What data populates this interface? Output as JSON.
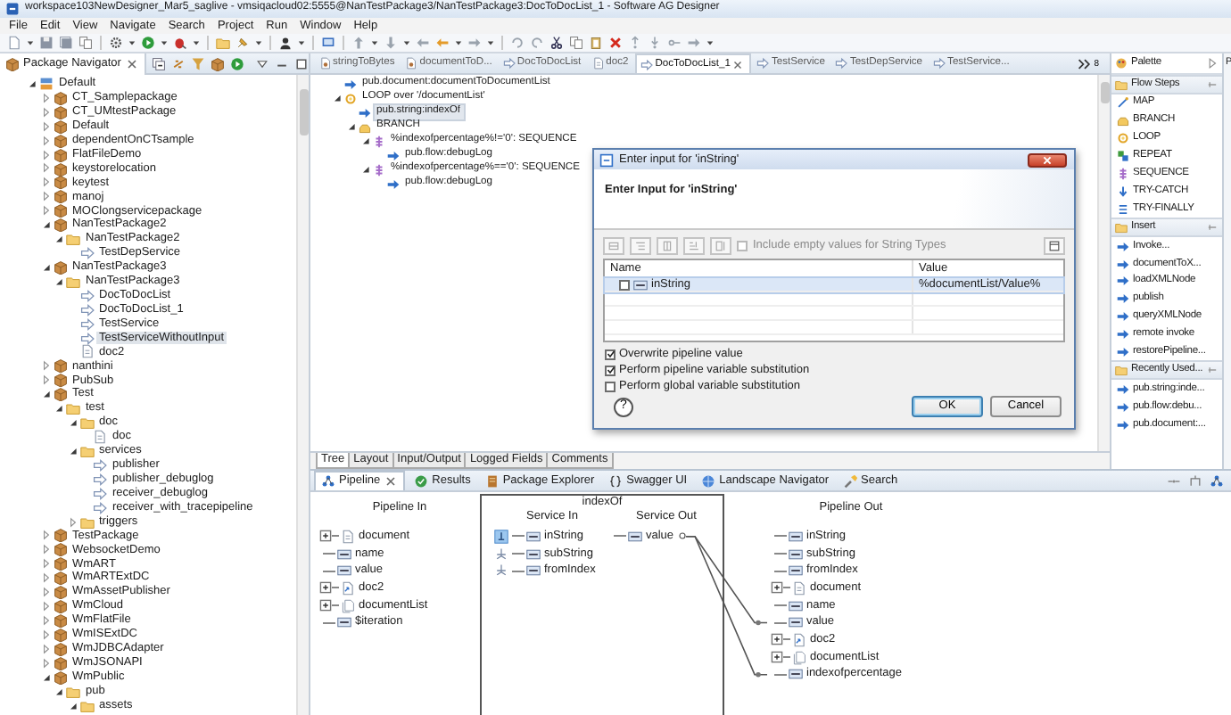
{
  "window": {
    "title": "workspace103NewDesigner_Mar5_saglive - vmsiqacloud02:5555@NanTestPackage3/NanTestPackage3:DocToDocList_1 - Software AG Designer"
  },
  "menu": [
    "File",
    "Edit",
    "View",
    "Navigate",
    "Search",
    "Project",
    "Run",
    "Window",
    "Help"
  ],
  "navigator": {
    "tab": {
      "label": "Package Navigator",
      "selected": true
    },
    "tree": [
      {
        "label": "Default",
        "kind": "server",
        "expanded": true,
        "selected": false,
        "children": [
          {
            "label": "CT_Samplepackage",
            "kind": "package",
            "expanded": false,
            "selected": false
          },
          {
            "label": "CT_UMtestPackage",
            "kind": "package",
            "expanded": false,
            "selected": false
          },
          {
            "label": "Default",
            "kind": "package",
            "expanded": false,
            "selected": false
          },
          {
            "label": "dependentOnCTsample",
            "kind": "package",
            "expanded": false,
            "selected": false
          },
          {
            "label": "FlatFileDemo",
            "kind": "package",
            "expanded": false,
            "selected": false
          },
          {
            "label": "keystorelocation",
            "kind": "package",
            "expanded": false,
            "selected": false
          },
          {
            "label": "keytest",
            "kind": "package",
            "expanded": false,
            "selected": false
          },
          {
            "label": "manoj",
            "kind": "package",
            "expanded": false,
            "selected": false
          },
          {
            "label": "MOClongservicepackage",
            "kind": "package",
            "expanded": false,
            "selected": false
          },
          {
            "label": "NanTestPackage2",
            "kind": "package",
            "expanded": true,
            "selected": false,
            "children": [
              {
                "label": "NanTestPackage2",
                "kind": "folder",
                "expanded": true,
                "selected": false,
                "children": [
                  {
                    "label": "TestDepService",
                    "kind": "service",
                    "selected": false
                  }
                ]
              }
            ]
          },
          {
            "label": "NanTestPackage3",
            "kind": "package",
            "expanded": true,
            "selected": false,
            "children": [
              {
                "label": "NanTestPackage3",
                "kind": "folder",
                "expanded": true,
                "selected": false,
                "children": [
                  {
                    "label": "DocToDocList",
                    "kind": "service",
                    "selected": false
                  },
                  {
                    "label": "DocToDocList_1",
                    "kind": "service",
                    "selected": false
                  },
                  {
                    "label": "TestService",
                    "kind": "service",
                    "selected": false
                  },
                  {
                    "label": "TestServiceWithoutInput",
                    "kind": "service",
                    "selected": true
                  },
                  {
                    "label": "doc2",
                    "kind": "document",
                    "selected": false
                  }
                ]
              }
            ]
          },
          {
            "label": "nanthini",
            "kind": "package",
            "expanded": false,
            "selected": false
          },
          {
            "label": "PubSub",
            "kind": "package",
            "expanded": false,
            "selected": false
          },
          {
            "label": "Test",
            "kind": "package",
            "expanded": true,
            "selected": false,
            "children": [
              {
                "label": "test",
                "kind": "folder",
                "expanded": true,
                "selected": false,
                "children": [
                  {
                    "label": "doc",
                    "kind": "folder",
                    "expanded": true,
                    "selected": false,
                    "children": [
                      {
                        "label": "doc",
                        "kind": "document",
                        "selected": false
                      }
                    ]
                  },
                  {
                    "label": "services",
                    "kind": "folder",
                    "expanded": true,
                    "selected": false,
                    "children": [
                      {
                        "label": "publisher",
                        "kind": "service",
                        "selected": false
                      },
                      {
                        "label": "publisher_debuglog",
                        "kind": "service",
                        "selected": false
                      },
                      {
                        "label": "receiver_debuglog",
                        "kind": "service",
                        "selected": false
                      },
                      {
                        "label": "receiver_with_tracepipeline",
                        "kind": "service",
                        "selected": false
                      }
                    ]
                  },
                  {
                    "label": "triggers",
                    "kind": "folder",
                    "expanded": false,
                    "selected": false
                  }
                ]
              }
            ]
          },
          {
            "label": "TestPackage",
            "kind": "package",
            "expanded": false,
            "selected": false
          },
          {
            "label": "WebsocketDemo",
            "kind": "package",
            "expanded": false,
            "selected": false
          },
          {
            "label": "WmART",
            "kind": "package",
            "expanded": false,
            "selected": false
          },
          {
            "label": "WmARTExtDC",
            "kind": "package",
            "expanded": false,
            "selected": false
          },
          {
            "label": "WmAssetPublisher",
            "kind": "package",
            "expanded": false,
            "selected": false
          },
          {
            "label": "WmCloud",
            "kind": "package",
            "expanded": false,
            "selected": false
          },
          {
            "label": "WmFlatFile",
            "kind": "package",
            "expanded": false,
            "selected": false
          },
          {
            "label": "WmISExtDC",
            "kind": "package",
            "expanded": false,
            "selected": false
          },
          {
            "label": "WmJDBCAdapter",
            "kind": "package",
            "expanded": false,
            "selected": false
          },
          {
            "label": "WmJSONAPI",
            "kind": "package",
            "expanded": false,
            "selected": false
          },
          {
            "label": "WmPublic",
            "kind": "package",
            "expanded": true,
            "selected": false,
            "children": [
              {
                "label": "pub",
                "kind": "folder",
                "expanded": true,
                "selected": false,
                "children": [
                  {
                    "label": "assets",
                    "kind": "folder",
                    "expanded": true,
                    "selected": false
                  }
                ]
              }
            ]
          }
        ]
      }
    ]
  },
  "editor": {
    "tabs": [
      {
        "label": "stringToBytes",
        "kind": "java",
        "selected": false
      },
      {
        "label": "documentToD...",
        "kind": "java",
        "selected": false
      },
      {
        "label": "DocToDocList",
        "kind": "service",
        "selected": false
      },
      {
        "label": "doc2",
        "kind": "document",
        "selected": false
      },
      {
        "label": "DocToDocList_1",
        "kind": "service",
        "selected": true
      },
      {
        "label": "TestService",
        "kind": "service",
        "selected": false
      },
      {
        "label": "TestDepService",
        "kind": "service",
        "selected": false
      },
      {
        "label": "TestService...",
        "kind": "service",
        "selected": false
      }
    ],
    "hidden_tab_count": "8",
    "flow": [
      {
        "label": "pub.document:documentToDocumentList",
        "kind": "invoke",
        "selected": false
      },
      {
        "label": "LOOP over '/documentList'",
        "kind": "loop",
        "expanded": true,
        "selected": false,
        "children": [
          {
            "label": "pub.string:indexOf",
            "kind": "invoke",
            "selected": true
          },
          {
            "label": "BRANCH",
            "kind": "branch",
            "expanded": true,
            "selected": false,
            "children": [
              {
                "label": "%indexofpercentage%!='0': SEQUENCE",
                "kind": "sequence",
                "expanded": true,
                "selected": false,
                "children": [
                  {
                    "label": "pub.flow:debugLog",
                    "kind": "invoke",
                    "selected": false
                  }
                ]
              },
              {
                "label": "%indexofpercentage%=='0': SEQUENCE",
                "kind": "sequence",
                "expanded": true,
                "selected": false,
                "children": [
                  {
                    "label": "pub.flow:debugLog",
                    "kind": "invoke",
                    "selected": false
                  }
                ]
              }
            ]
          }
        ]
      }
    ],
    "bottom_tabs": [
      {
        "label": "Tree",
        "selected": true
      },
      {
        "label": "Layout",
        "selected": false
      },
      {
        "label": "Input/Output",
        "selected": false
      },
      {
        "label": "Logged Fields",
        "selected": false
      },
      {
        "label": "Comments",
        "selected": false
      }
    ]
  },
  "dialog": {
    "title": "Enter input for 'inString'",
    "heading": "Enter Input for 'inString'",
    "include_empty": {
      "label": "Include empty values for String Types",
      "checked": false,
      "disabled": true
    },
    "columns": [
      "Name",
      "Value"
    ],
    "rows": [
      {
        "name": "inString",
        "kind": "string",
        "value": "%documentList/Value%",
        "checked": false,
        "selected": true
      }
    ],
    "options": [
      {
        "label": "Overwrite pipeline value",
        "checked": true
      },
      {
        "label": "Perform pipeline variable substitution",
        "checked": true
      },
      {
        "label": "Perform global variable substitution",
        "checked": false
      }
    ],
    "help": "?",
    "buttons": [
      {
        "label": "OK",
        "default": true
      },
      {
        "label": "Cancel",
        "default": false
      }
    ]
  },
  "palette": {
    "title": "Palette",
    "sections": [
      {
        "title": "Flow Steps",
        "items": [
          {
            "label": "MAP",
            "kind": "map"
          },
          {
            "label": "BRANCH",
            "kind": "branch"
          },
          {
            "label": "LOOP",
            "kind": "loop"
          },
          {
            "label": "REPEAT",
            "kind": "repeat"
          },
          {
            "label": "SEQUENCE",
            "kind": "sequence"
          },
          {
            "label": "TRY-CATCH",
            "kind": "trycatch"
          },
          {
            "label": "TRY-FINALLY",
            "kind": "tryfinally"
          }
        ]
      },
      {
        "title": "Insert",
        "items": [
          {
            "label": "Invoke...",
            "kind": "invoke"
          },
          {
            "label": "documentToX...",
            "kind": "invoke"
          },
          {
            "label": "loadXMLNode",
            "kind": "invoke"
          },
          {
            "label": "publish",
            "kind": "invoke"
          },
          {
            "label": "queryXMLNode",
            "kind": "invoke"
          },
          {
            "label": "remote invoke",
            "kind": "invoke"
          },
          {
            "label": "restorePipeline...",
            "kind": "invoke"
          }
        ]
      },
      {
        "title": "Recently Used...",
        "items": [
          {
            "label": "pub.string:inde...",
            "kind": "invoke"
          },
          {
            "label": "pub.flow:debu...",
            "kind": "invoke"
          },
          {
            "label": "pub.document:...",
            "kind": "invoke"
          }
        ]
      }
    ]
  },
  "side_panel": {
    "title": "P"
  },
  "pipeline": {
    "tabs": [
      {
        "label": "Pipeline",
        "kind": "pipeline",
        "selected": true
      },
      {
        "label": "Results",
        "kind": "results",
        "selected": false
      },
      {
        "label": "Package Explorer",
        "kind": "explorer",
        "selected": false
      },
      {
        "label": "Swagger UI",
        "kind": "swagger",
        "selected": false
      },
      {
        "label": "Landscape Navigator",
        "kind": "landscape",
        "selected": false
      },
      {
        "label": "Search",
        "kind": "search",
        "selected": false
      }
    ],
    "pipeline_in": {
      "title": "Pipeline In",
      "items": [
        {
          "label": "document",
          "kind": "document",
          "expanded": false
        },
        {
          "label": "name",
          "kind": "string"
        },
        {
          "label": "value",
          "kind": "string"
        },
        {
          "label": "doc2",
          "kind": "docref",
          "expanded": false
        },
        {
          "label": "documentList",
          "kind": "doclist",
          "expanded": false
        },
        {
          "label": "$iteration",
          "kind": "string"
        }
      ]
    },
    "service": {
      "title": "indexOf",
      "in_title": "Service In",
      "in_items": [
        {
          "label": "inString",
          "kind": "string",
          "value_set": true
        },
        {
          "label": "subString",
          "kind": "string",
          "value_set": false
        },
        {
          "label": "fromIndex",
          "kind": "string",
          "value_set": false
        }
      ],
      "out_title": "Service Out",
      "out_items": [
        {
          "label": "value",
          "kind": "string"
        }
      ]
    },
    "pipeline_out": {
      "title": "Pipeline Out",
      "items": [
        {
          "label": "inString",
          "kind": "string",
          "mapped": false
        },
        {
          "label": "subString",
          "kind": "string",
          "mapped": false
        },
        {
          "label": "fromIndex",
          "kind": "string",
          "mapped": false
        },
        {
          "label": "document",
          "kind": "document",
          "expanded": false,
          "mapped": false
        },
        {
          "label": "name",
          "kind": "string",
          "mapped": false
        },
        {
          "label": "value",
          "kind": "string",
          "mapped": true
        },
        {
          "label": "doc2",
          "kind": "docref",
          "expanded": false,
          "mapped": false
        },
        {
          "label": "documentList",
          "kind": "doclist",
          "expanded": false,
          "mapped": false
        },
        {
          "label": "indexofpercentage",
          "kind": "string",
          "mapped": true
        }
      ]
    }
  }
}
